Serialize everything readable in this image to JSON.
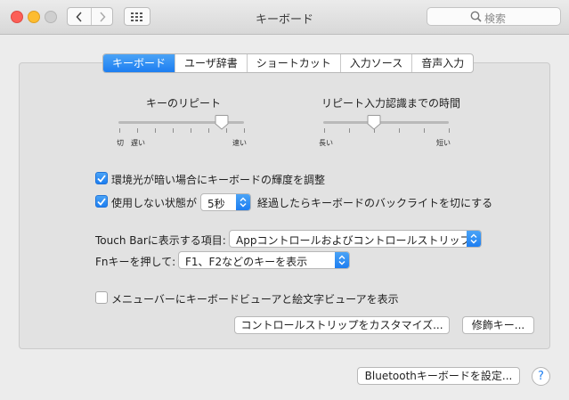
{
  "window": {
    "title": "キーボード"
  },
  "search": {
    "placeholder": "検索",
    "icon": "magnifier"
  },
  "toolbar": {
    "back_icon": "chevron-left",
    "forward_icon": "chevron-right",
    "grid_icon": "grid"
  },
  "tabs": [
    {
      "label": "キーボード",
      "active": true
    },
    {
      "label": "ユーザ辞書",
      "active": false
    },
    {
      "label": "ショートカット",
      "active": false
    },
    {
      "label": "入力ソース",
      "active": false
    },
    {
      "label": "音声入力",
      "active": false
    }
  ],
  "key_repeat": {
    "title": "キーのリピート",
    "label_off": "切",
    "label_slow": "遅い",
    "label_fast": "速い",
    "level": 0.82
  },
  "delay_until_repeat": {
    "title": "リピート入力認識までの時間",
    "label_long": "長い",
    "label_short": "短い",
    "level": 0.4
  },
  "options": {
    "adjust_brightness": {
      "label": "環境光が暗い場合にキーボードの輝度を調整",
      "checked": true
    },
    "backlight_off": {
      "prefix": "使用しない状態が",
      "value": "5秒",
      "suffix": "経過したらキーボードのバックライトを切にする",
      "checked": true
    },
    "show_viewers": {
      "label": "メニューバーにキーボードビューアと絵文字ビューアを表示",
      "checked": false
    }
  },
  "touchbar": {
    "label": "Touch Barに表示する項目:",
    "value": "Appコントロールおよびコントロールストリップ"
  },
  "fn_key": {
    "label": "Fnキーを押して:",
    "value": "F1、F2などのキーを表示"
  },
  "buttons": {
    "customize": "コントロールストリップをカスタマイズ...",
    "modifier": "修飾キー...",
    "bluetooth": "Bluetoothキーボードを設定..."
  },
  "help": {
    "label": "?"
  },
  "colors": {
    "accent": "#1d7ef1",
    "panel": "#e2e2e2",
    "window": "#ececec"
  }
}
